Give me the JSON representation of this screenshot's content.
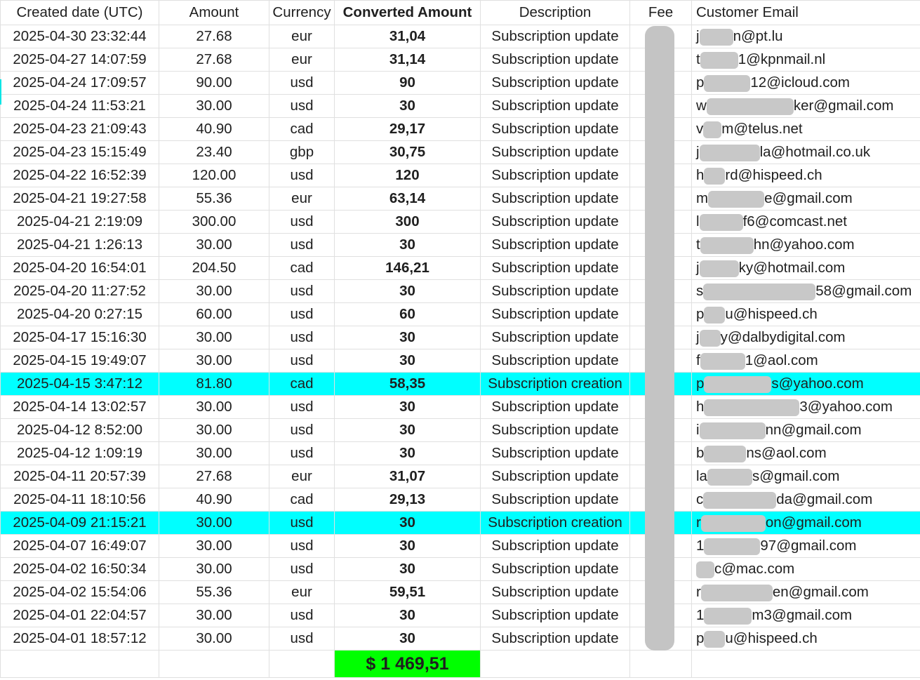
{
  "headers": {
    "created": "Created date (UTC)",
    "amount": "Amount",
    "currency": "Currency",
    "converted": "Converted Amount",
    "description": "Description",
    "fee": "Fee",
    "email": "Customer Email"
  },
  "colors": {
    "highlight": "#00ffff",
    "total_bg": "#00ff00",
    "redaction": "#c4c4c4"
  },
  "rows": [
    {
      "date": "2025-04-30 23:32:44",
      "amount": "27.68",
      "currency": "eur",
      "converted": "31,04",
      "desc": "Subscription update",
      "email_pre": "j",
      "email_post": "n@pt.lu",
      "hl": false
    },
    {
      "date": "2025-04-27 14:07:59",
      "amount": "27.68",
      "currency": "eur",
      "converted": "31,14",
      "desc": "Subscription update",
      "email_pre": "t",
      "email_post": "1@kpnmail.nl",
      "hl": false
    },
    {
      "date": "2025-04-24 17:09:57",
      "amount": "90.00",
      "currency": "usd",
      "converted": "90",
      "desc": "Subscription update",
      "email_pre": "p",
      "email_post": "12@icloud.com",
      "hl": false
    },
    {
      "date": "2025-04-24 11:53:21",
      "amount": "30.00",
      "currency": "usd",
      "converted": "30",
      "desc": "Subscription update",
      "email_pre": "w",
      "email_post": "ker@gmail.com",
      "hl": false
    },
    {
      "date": "2025-04-23 21:09:43",
      "amount": "40.90",
      "currency": "cad",
      "converted": "29,17",
      "desc": "Subscription update",
      "email_pre": "v",
      "email_post": "m@telus.net",
      "hl": false
    },
    {
      "date": "2025-04-23 15:15:49",
      "amount": "23.40",
      "currency": "gbp",
      "converted": "30,75",
      "desc": "Subscription update",
      "email_pre": "j",
      "email_post": "la@hotmail.co.uk",
      "hl": false
    },
    {
      "date": "2025-04-22 16:52:39",
      "amount": "120.00",
      "currency": "usd",
      "converted": "120",
      "desc": "Subscription update",
      "email_pre": "h",
      "email_post": "rd@hispeed.ch",
      "hl": false
    },
    {
      "date": "2025-04-21 19:27:58",
      "amount": "55.36",
      "currency": "eur",
      "converted": "63,14",
      "desc": "Subscription update",
      "email_pre": "m",
      "email_post": "e@gmail.com",
      "hl": false
    },
    {
      "date": "2025-04-21 2:19:09",
      "amount": "300.00",
      "currency": "usd",
      "converted": "300",
      "desc": "Subscription update",
      "email_pre": "l",
      "email_post": "f6@comcast.net",
      "hl": false
    },
    {
      "date": "2025-04-21 1:26:13",
      "amount": "30.00",
      "currency": "usd",
      "converted": "30",
      "desc": "Subscription update",
      "email_pre": "t",
      "email_post": "hn@yahoo.com",
      "hl": false
    },
    {
      "date": "2025-04-20 16:54:01",
      "amount": "204.50",
      "currency": "cad",
      "converted": "146,21",
      "desc": "Subscription update",
      "email_pre": "j",
      "email_post": "ky@hotmail.com",
      "hl": false
    },
    {
      "date": "2025-04-20 11:27:52",
      "amount": "30.00",
      "currency": "usd",
      "converted": "30",
      "desc": "Subscription update",
      "email_pre": "s",
      "email_post": "58@gmail.com",
      "hl": false
    },
    {
      "date": "2025-04-20 0:27:15",
      "amount": "60.00",
      "currency": "usd",
      "converted": "60",
      "desc": "Subscription update",
      "email_pre": "p",
      "email_post": "u@hispeed.ch",
      "hl": false
    },
    {
      "date": "2025-04-17 15:16:30",
      "amount": "30.00",
      "currency": "usd",
      "converted": "30",
      "desc": "Subscription update",
      "email_pre": "j",
      "email_post": "y@dalbydigital.com",
      "hl": false
    },
    {
      "date": "2025-04-15 19:49:07",
      "amount": "30.00",
      "currency": "usd",
      "converted": "30",
      "desc": "Subscription update",
      "email_pre": "f",
      "email_post": "1@aol.com",
      "hl": false
    },
    {
      "date": "2025-04-15 3:47:12",
      "amount": "81.80",
      "currency": "cad",
      "converted": "58,35",
      "desc": "Subscription creation",
      "email_pre": "p",
      "email_post": "s@yahoo.com",
      "hl": true
    },
    {
      "date": "2025-04-14 13:02:57",
      "amount": "30.00",
      "currency": "usd",
      "converted": "30",
      "desc": "Subscription update",
      "email_pre": "h",
      "email_post": "3@yahoo.com",
      "hl": false
    },
    {
      "date": "2025-04-12 8:52:00",
      "amount": "30.00",
      "currency": "usd",
      "converted": "30",
      "desc": "Subscription update",
      "email_pre": "i",
      "email_post": "nn@gmail.com",
      "hl": false
    },
    {
      "date": "2025-04-12 1:09:19",
      "amount": "30.00",
      "currency": "usd",
      "converted": "30",
      "desc": "Subscription update",
      "email_pre": "b",
      "email_post": "ns@aol.com",
      "hl": false
    },
    {
      "date": "2025-04-11 20:57:39",
      "amount": "27.68",
      "currency": "eur",
      "converted": "31,07",
      "desc": "Subscription update",
      "email_pre": "la",
      "email_post": "s@gmail.com",
      "hl": false
    },
    {
      "date": "2025-04-11 18:10:56",
      "amount": "40.90",
      "currency": "cad",
      "converted": "29,13",
      "desc": "Subscription update",
      "email_pre": "c",
      "email_post": "da@gmail.com",
      "hl": false
    },
    {
      "date": "2025-04-09 21:15:21",
      "amount": "30.00",
      "currency": "usd",
      "converted": "30",
      "desc": "Subscription creation",
      "email_pre": "r",
      "email_post": "on@gmail.com",
      "hl": true
    },
    {
      "date": "2025-04-07 16:49:07",
      "amount": "30.00",
      "currency": "usd",
      "converted": "30",
      "desc": "Subscription update",
      "email_pre": "1",
      "email_post": "97@gmail.com",
      "hl": false
    },
    {
      "date": "2025-04-02 16:50:34",
      "amount": "30.00",
      "currency": "usd",
      "converted": "30",
      "desc": "Subscription update",
      "email_pre": "",
      "email_post": "c@mac.com",
      "hl": false
    },
    {
      "date": "2025-04-02 15:54:06",
      "amount": "55.36",
      "currency": "eur",
      "converted": "59,51",
      "desc": "Subscription update",
      "email_pre": "r",
      "email_post": "en@gmail.com",
      "hl": false
    },
    {
      "date": "2025-04-01 22:04:57",
      "amount": "30.00",
      "currency": "usd",
      "converted": "30",
      "desc": "Subscription update",
      "email_pre": "1",
      "email_post": "m3@gmail.com",
      "hl": false
    },
    {
      "date": "2025-04-01 18:57:12",
      "amount": "30.00",
      "currency": "usd",
      "converted": "30",
      "desc": "Subscription update",
      "email_pre": "p",
      "email_post": "u@hispeed.ch",
      "hl": false
    }
  ],
  "redaction_widths": [
    48,
    54,
    66,
    124,
    26,
    86,
    30,
    80,
    62,
    76,
    56,
    160,
    30,
    30,
    64,
    96,
    136,
    94,
    60,
    64,
    104,
    92,
    80,
    26,
    102,
    68,
    30
  ],
  "total": "$ 1 469,51"
}
